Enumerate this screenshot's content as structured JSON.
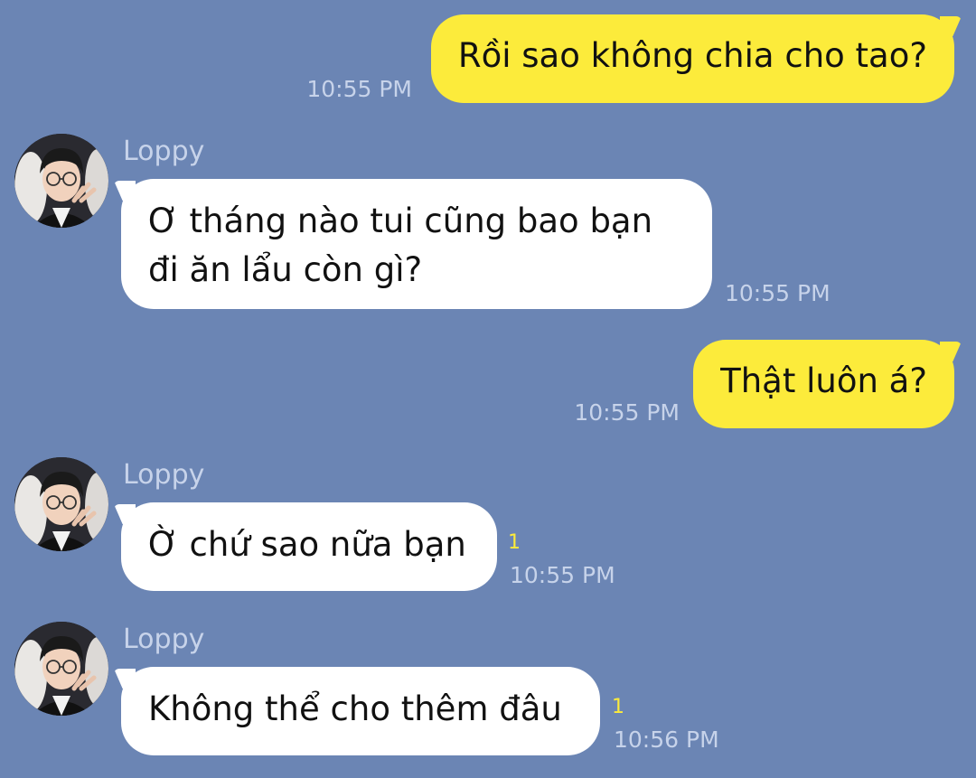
{
  "colors": {
    "background": "#6b85b4",
    "outgoing_bubble": "#fceb3b",
    "incoming_bubble": "#ffffff",
    "meta_text": "#c7d3ea",
    "unread_count": "#fceb3b"
  },
  "messages": [
    {
      "direction": "outgoing",
      "text": "Rồi sao không chia cho tao?",
      "time": "10:55 PM"
    },
    {
      "direction": "incoming",
      "sender": "Loppy",
      "avatar_icon": "user-avatar-photo",
      "lines": [
        "Ơ tháng nào tui cũng bao bạn",
        "đi ăn lẩu còn gì?"
      ],
      "time": "10:55 PM"
    },
    {
      "direction": "outgoing",
      "text": "Thật luôn á?",
      "time": "10:55 PM"
    },
    {
      "direction": "incoming",
      "sender": "Loppy",
      "avatar_icon": "user-avatar-photo",
      "text": "Ờ chứ sao nữa bạn",
      "unread": "1",
      "time": "10:55 PM"
    },
    {
      "direction": "incoming",
      "sender": "Loppy",
      "avatar_icon": "user-avatar-photo",
      "text": "Không thể cho thêm đâu",
      "unread": "1",
      "time": "10:56 PM"
    }
  ]
}
